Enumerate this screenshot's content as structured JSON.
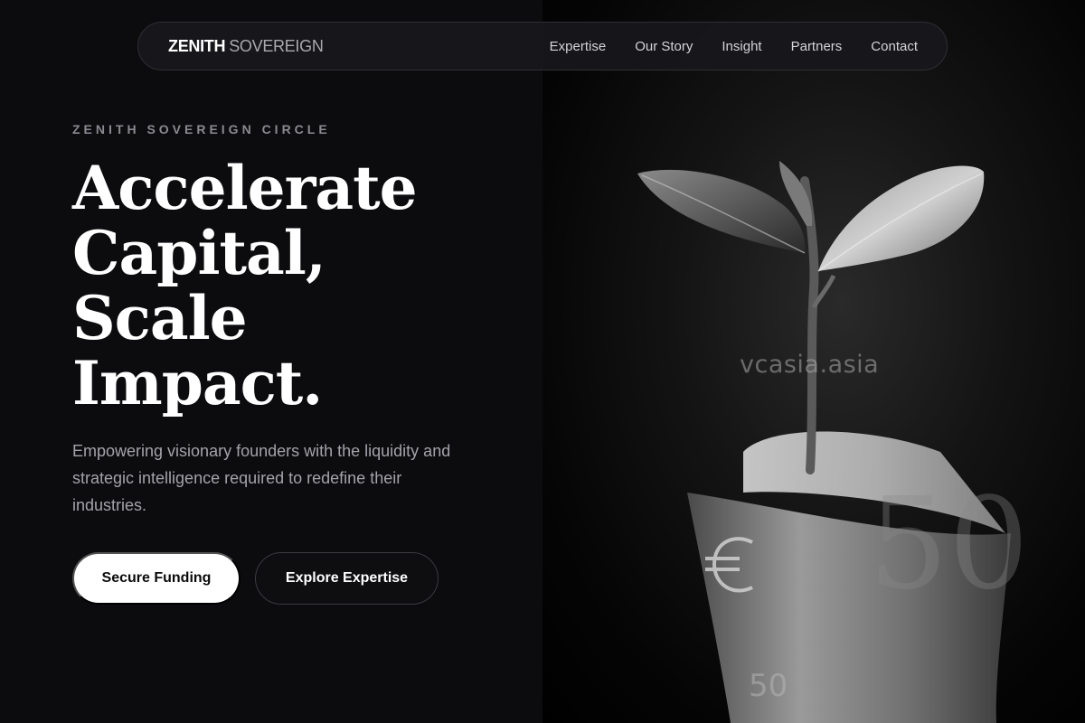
{
  "brand": {
    "name_strong": "ZENITH",
    "name_light": "SOVEREIGN"
  },
  "nav": {
    "items": [
      "Expertise",
      "Our Story",
      "Insight",
      "Partners",
      "Contact"
    ]
  },
  "hero": {
    "eyebrow": "ZENITH SOVEREIGN CIRCLE",
    "headline": [
      "Accelerate",
      "Capital,",
      "Scale",
      "Impact."
    ],
    "subtext": "Empowering visionary founders with the liquidity and strategic intelligence required to redefine their industries.",
    "primary_cta": "Secure Funding",
    "secondary_cta": "Explore Expertise"
  },
  "image": {
    "watermark": "vcasia.asia",
    "subject": "seedling-in-euro-banknote"
  },
  "colors": {
    "background": "#0c0c0e",
    "accent": "#ffffff",
    "muted_text": "#a3a3a9"
  }
}
